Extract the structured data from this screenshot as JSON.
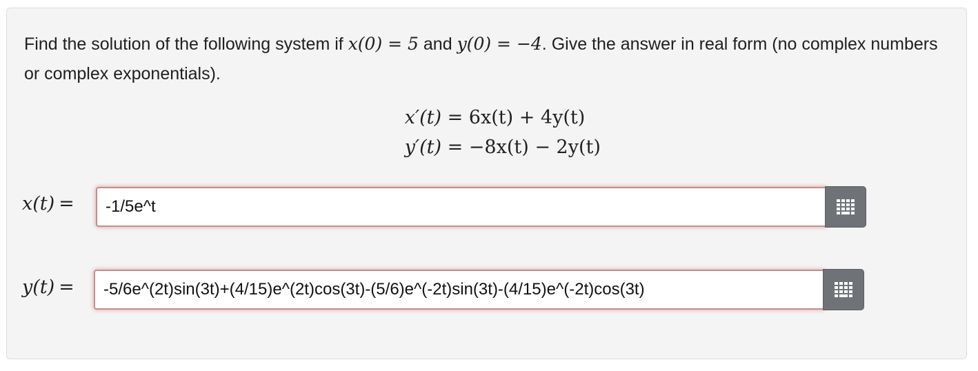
{
  "problem": {
    "text_1": "Find the solution of the following system if ",
    "x0_math": "x(0) = 5",
    "text_2": " and ",
    "y0_math": "y(0) = −4",
    "text_3": ". Give the answer in real form (no complex numbers or complex exponentials)."
  },
  "system": {
    "eq1_lhs": "x′(t)",
    "eq1_rhs": "= 6x(t) + 4y(t)",
    "eq2_lhs": "y′(t)",
    "eq2_rhs": "= −8x(t) − 2y(t)"
  },
  "answers": {
    "x_label": "x(t)",
    "x_eq": "=",
    "x_value": "-1/5e^t",
    "y_label": "y(t)",
    "y_eq": "=",
    "y_value": "-5/6e^(2t)sin(3t)+(4/15)e^(2t)cos(3t)-(5/6)e^(-2t)sin(3t)-(4/15)e^(-2t)cos(3t)"
  },
  "icons": {
    "keypad": "keypad-icon"
  },
  "colors": {
    "panel_bg": "#f4f4f4",
    "field_error_border": "#c98b8b",
    "keypad_button": "#6f7276"
  }
}
